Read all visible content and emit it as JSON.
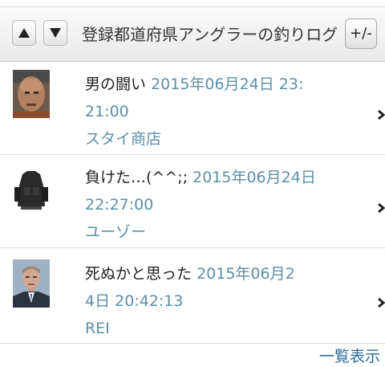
{
  "header": {
    "title": "登録都道府県アングラーの釣りログ",
    "toggle_label": "+/-",
    "up_icon": "arrow-up-icon",
    "down_icon": "arrow-down-icon"
  },
  "posts": [
    {
      "title": "男の闘い",
      "date_line1": "2015年06月24日 23:",
      "date_line2": "21:00",
      "author": "スタイ商店",
      "avatar": "man-face-avatar"
    },
    {
      "title": "負けた…(^^;;",
      "date_line1": "2015年06月24日",
      "date_line2": "22:27:00",
      "author": "ユーゾー",
      "avatar": "vest-avatar"
    },
    {
      "title": "死ぬかと思った",
      "date_line1": "2015年06月2",
      "date_line2": "4日 20:42:13",
      "author": "REI",
      "avatar": "suit-man-avatar"
    }
  ],
  "footer": {
    "more_label": "一覧表示"
  }
}
